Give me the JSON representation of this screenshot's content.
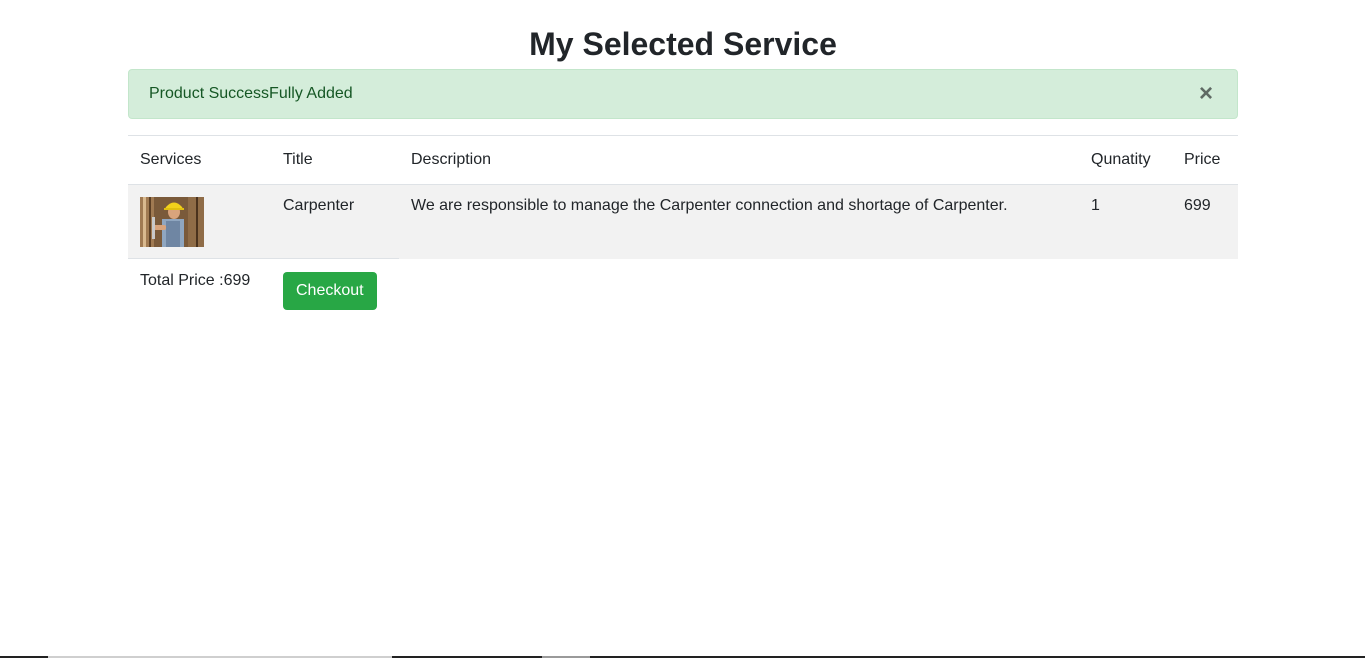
{
  "page": {
    "title": "My Selected Service"
  },
  "alert": {
    "message": "Product SuccessFully Added",
    "close_symbol": "×",
    "color_bg": "#d4edda",
    "color_text": "#155724"
  },
  "table": {
    "headers": {
      "services": "Services",
      "title": "Title",
      "description": "Description",
      "quantity": "Qunatity",
      "price": "Price"
    },
    "rows": [
      {
        "image": "carpenter-worker-photo",
        "title": "Carpenter",
        "description": "We are responsible to manage the Carpenter connection and shortage of Carpenter.",
        "quantity": "1",
        "price": "699"
      }
    ]
  },
  "summary": {
    "total_label": "Total Price :699",
    "checkout_label": "Checkout",
    "button_color": "#28a745"
  }
}
